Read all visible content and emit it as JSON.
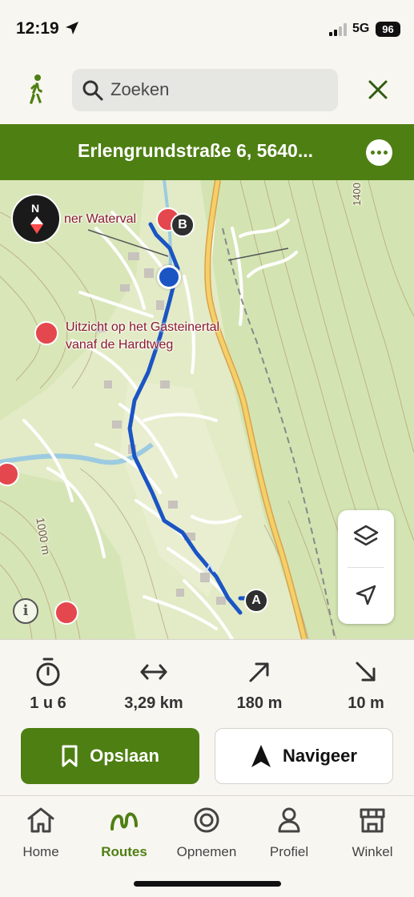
{
  "status_bar": {
    "time": "12:19",
    "network": "5G",
    "battery": "96"
  },
  "search": {
    "placeholder": "Zoeken"
  },
  "route": {
    "title": "Erlengrundstraße 6, 5640..."
  },
  "map": {
    "labels": {
      "waterfall": "ner Waterval",
      "viewpoint_line1": "Uitzicht op het Gasteinertal",
      "viewpoint_line2": "vanaf de Hardtweg",
      "contour_1000": "1000 m",
      "contour_1400": "1400"
    },
    "markers": {
      "start": "A",
      "end": "B"
    },
    "compass_letter": "N",
    "info_glyph": "i"
  },
  "stats": [
    {
      "icon": "stopwatch-icon",
      "value": "1 u 6"
    },
    {
      "icon": "distance-icon",
      "value": "3,29 km"
    },
    {
      "icon": "ascent-icon",
      "value": "180 m"
    },
    {
      "icon": "descent-icon",
      "value": "10 m"
    }
  ],
  "actions": {
    "save_label": "Opslaan",
    "navigate_label": "Navigeer"
  },
  "tabs": [
    {
      "label": "Home",
      "icon": "home-icon",
      "active": false
    },
    {
      "label": "Routes",
      "icon": "routes-icon",
      "active": true
    },
    {
      "label": "Opnemen",
      "icon": "record-icon",
      "active": false
    },
    {
      "label": "Profiel",
      "icon": "profile-icon",
      "active": false
    },
    {
      "label": "Winkel",
      "icon": "shop-icon",
      "active": false
    }
  ],
  "colors": {
    "brand_green": "#4e7f13",
    "route_blue": "#1b55c4",
    "poi_red": "#e4474d"
  }
}
